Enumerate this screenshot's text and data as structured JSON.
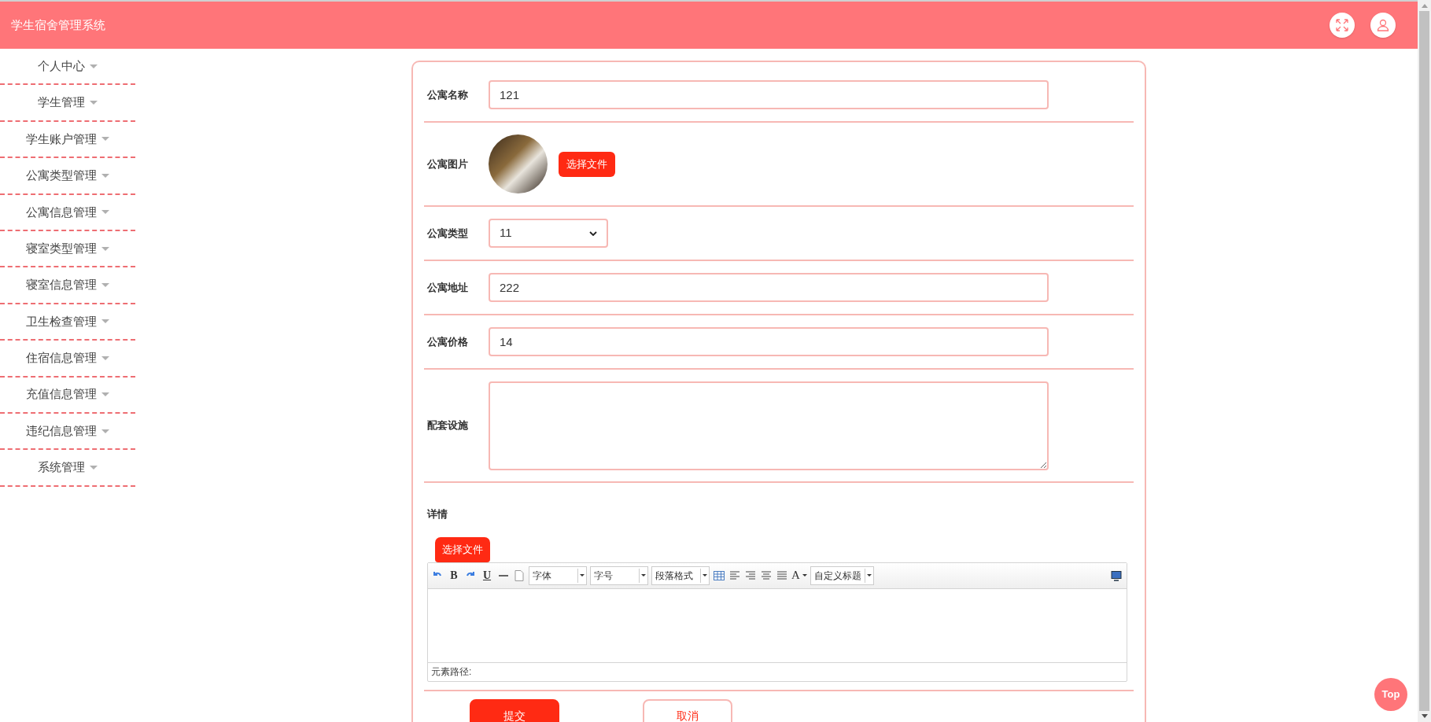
{
  "header": {
    "title": "学生宿舍管理系统"
  },
  "sidebar": {
    "items": [
      {
        "label": "个人中心"
      },
      {
        "label": "学生管理"
      },
      {
        "label": "学生账户管理"
      },
      {
        "label": "公寓类型管理"
      },
      {
        "label": "公寓信息管理"
      },
      {
        "label": "寝室类型管理"
      },
      {
        "label": "寝室信息管理"
      },
      {
        "label": "卫生检查管理"
      },
      {
        "label": "住宿信息管理"
      },
      {
        "label": "充值信息管理"
      },
      {
        "label": "违纪信息管理"
      },
      {
        "label": "系统管理"
      }
    ]
  },
  "form": {
    "fields": [
      {
        "kind": "text",
        "label": "公寓名称",
        "value": "121"
      },
      {
        "kind": "image",
        "label": "公寓图片",
        "button": "选择文件"
      },
      {
        "kind": "select",
        "label": "公寓类型",
        "value": "11"
      },
      {
        "kind": "text",
        "label": "公寓地址",
        "value": "222"
      },
      {
        "kind": "text",
        "label": "公寓价格",
        "value": "14"
      },
      {
        "kind": "textarea",
        "label": "配套设施"
      }
    ],
    "details": {
      "label": "详情",
      "button": "选择文件",
      "toolbar": [
        {
          "kind": "undo"
        },
        {
          "kind": "text",
          "label": "B"
        },
        {
          "kind": "redo"
        },
        {
          "kind": "underline",
          "label": "U"
        },
        {
          "kind": "hr"
        },
        {
          "kind": "page"
        },
        {
          "kind": "dropdown",
          "label": "字体"
        },
        {
          "kind": "dropdown",
          "label": "字号"
        },
        {
          "kind": "dropdown",
          "label": "段落格式"
        },
        {
          "kind": "table"
        },
        {
          "kind": "align-left"
        },
        {
          "kind": "align-right"
        },
        {
          "kind": "align-center"
        },
        {
          "kind": "justify"
        },
        {
          "kind": "color",
          "label": "A"
        },
        {
          "kind": "dropdown",
          "label": "自定义标题"
        }
      ],
      "status": "元素路径:"
    },
    "buttons": [
      {
        "kind": "primary",
        "label": "提交"
      },
      {
        "kind": "outline",
        "label": "取消"
      }
    ]
  },
  "back_to_top": "Top"
}
